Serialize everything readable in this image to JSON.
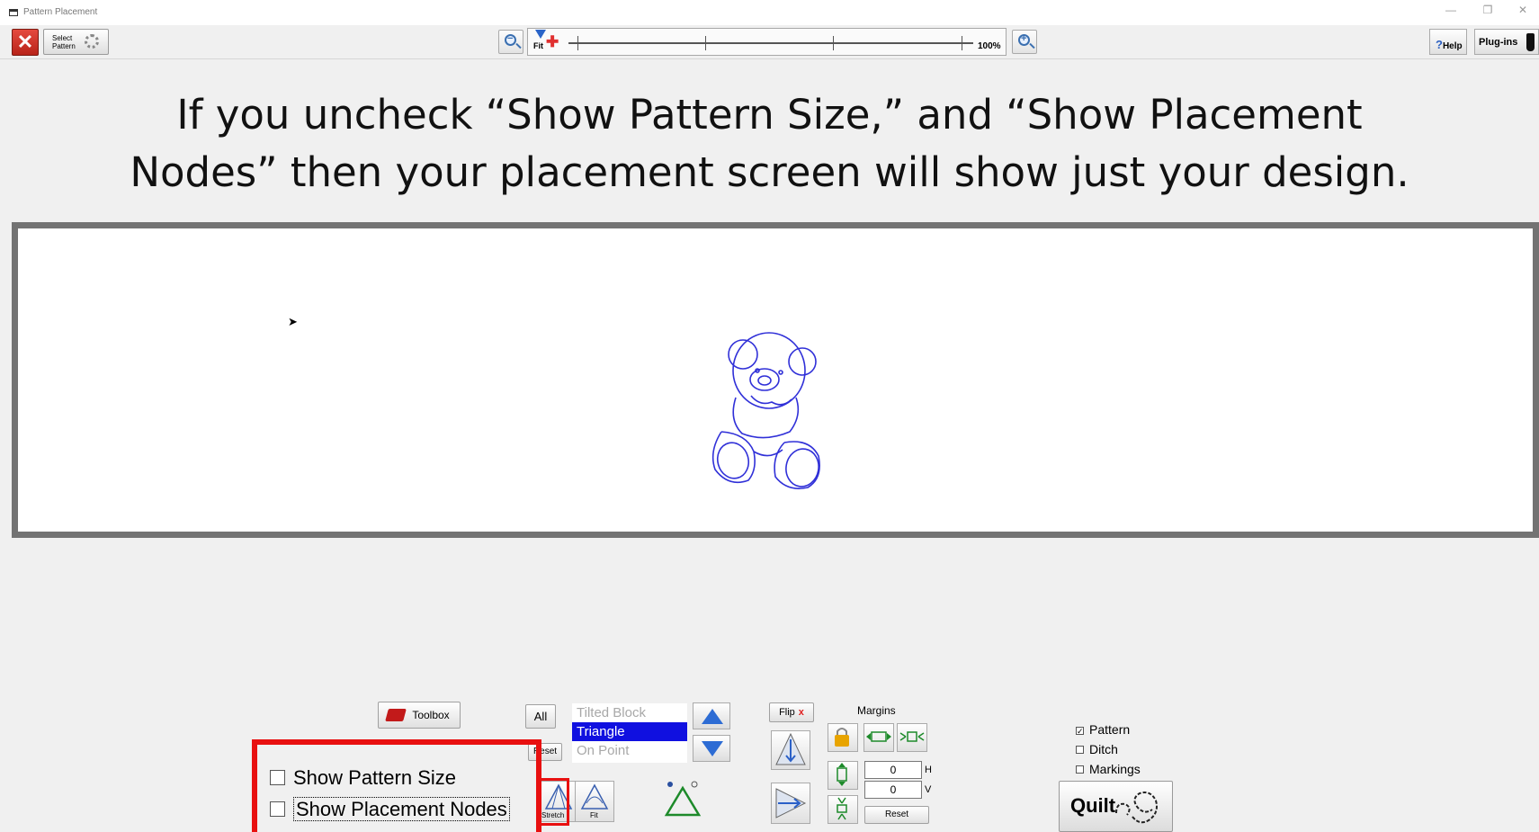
{
  "window": {
    "title": "Pattern Placement",
    "controls": [
      "—",
      "❐",
      "✕"
    ]
  },
  "toolbar": {
    "close_label": "✕",
    "select_pattern_line1": "Select",
    "select_pattern_line2": "Pattern",
    "fit_label": "Fit",
    "zoom_percent": "100%",
    "help_label": "Help",
    "help_q": "?",
    "plugins_label": "Plug-ins"
  },
  "caption": {
    "line1": "If you uncheck “Show Pattern Size,” and “Show Placement",
    "line2": "Nodes” then your placement screen will show just your design."
  },
  "controls": {
    "toolbox_label": "Toolbox",
    "all_label": "All",
    "reset_label": "Reset",
    "styles": [
      "Tilted Block",
      "Triangle",
      "On Point"
    ],
    "selected_style": "Triangle",
    "stretch_label": "Stretch",
    "fit_label": "Fit",
    "flip_label": "Flip",
    "flip_x": "x",
    "margins_label": "Margins",
    "h_value": "0",
    "v_value": "0",
    "h_label": "H",
    "v_label": "V",
    "margins_reset_label": "Reset",
    "layers": [
      {
        "label": "Pattern",
        "checked": true
      },
      {
        "label": "Ditch",
        "checked": false
      },
      {
        "label": "Markings",
        "checked": false
      }
    ],
    "quilt_label": "Quilt",
    "show_pattern_size_label": "Show Pattern Size",
    "show_pattern_size_checked": false,
    "show_placement_nodes_label": "Show Placement Nodes",
    "show_placement_nodes_checked": false
  },
  "colors": {
    "highlight": "#e81010",
    "pattern_stroke": "#3030d8",
    "selected_style_bg": "#1010e0"
  }
}
